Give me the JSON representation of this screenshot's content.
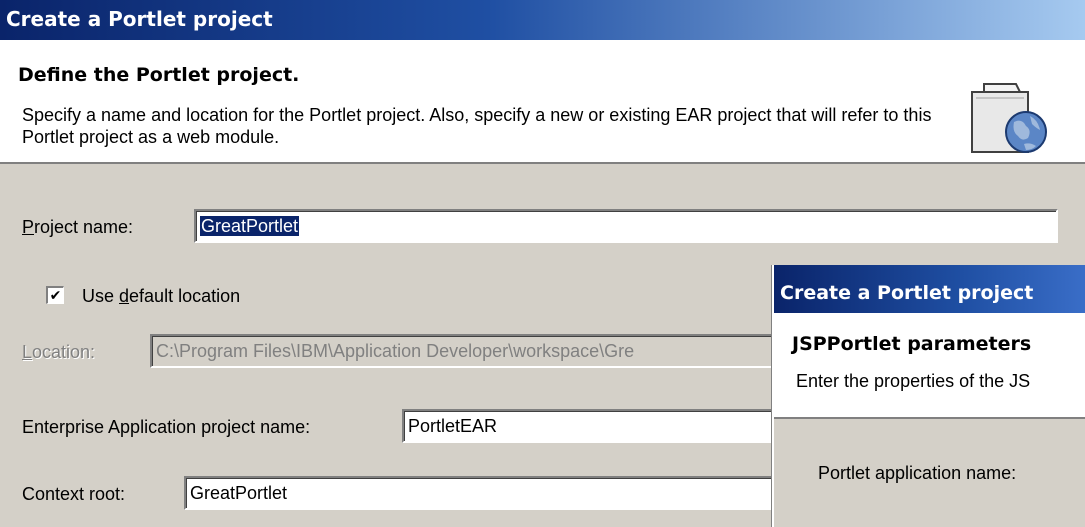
{
  "window": {
    "title": "Create a Portlet project"
  },
  "banner": {
    "title": "Define the Portlet project.",
    "description": "Specify a name and location for the Portlet project.  Also, specify a new or existing EAR project that will refer to this Portlet project as a web module.",
    "icon": "folder-globe-icon"
  },
  "form": {
    "project_name": {
      "label": "Project name:",
      "value": "GreatPortlet"
    },
    "use_default_location": {
      "label": "Use default location",
      "checked": true
    },
    "location": {
      "label": "Location:",
      "value": "C:\\Program Files\\IBM\\Application Developer\\workspace\\Gre"
    },
    "ear_project": {
      "label": "Enterprise Application project name:",
      "value": "PortletEAR"
    },
    "context_root": {
      "label": "Context root:",
      "value": "GreatPortlet"
    }
  },
  "overlay": {
    "title": "Create a Portlet project",
    "banner_title": "JSPPortlet parameters",
    "banner_description": "Enter the properties of the JS",
    "field_label": "Portlet application name:"
  },
  "colors": {
    "titlebar_start": "#0a246a",
    "titlebar_end": "#a6caf0",
    "dialog_bg": "#d4d0c8",
    "selection": "#0a246a"
  }
}
